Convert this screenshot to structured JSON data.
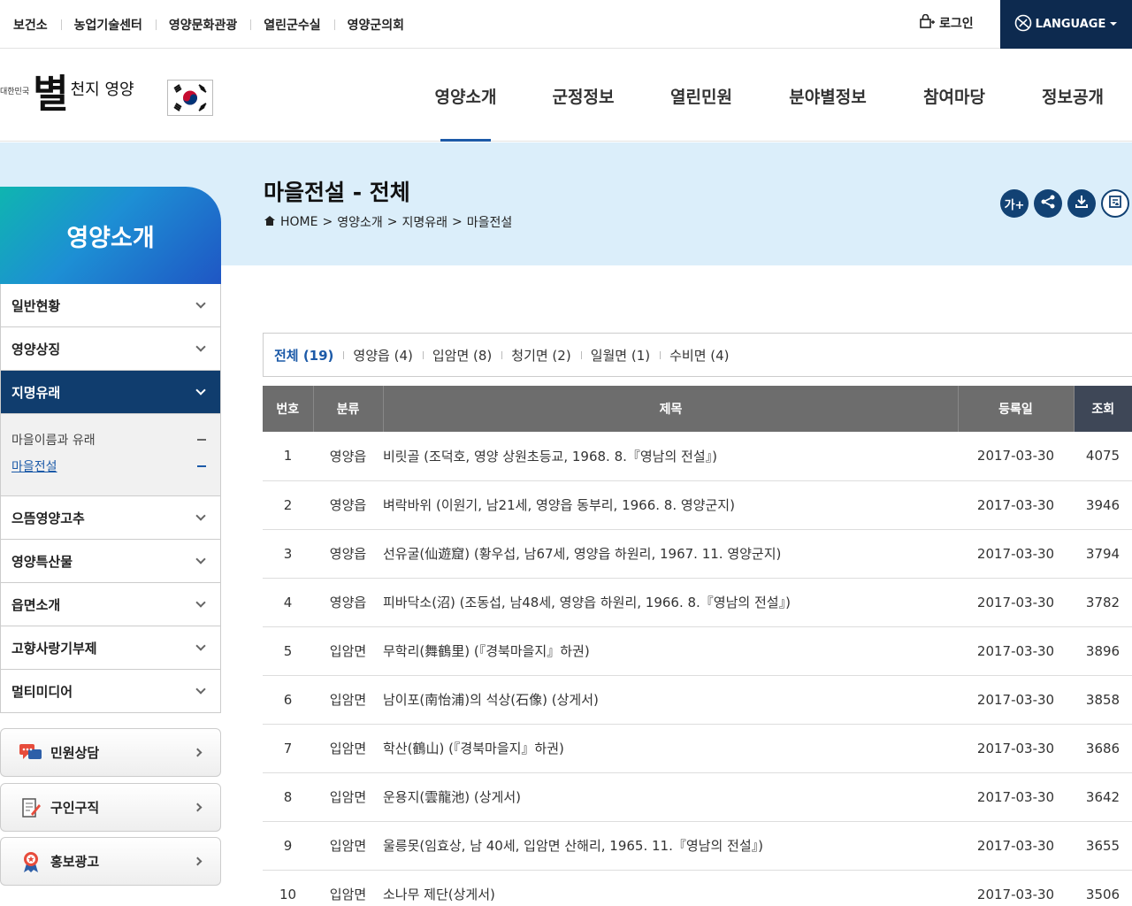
{
  "top_links": [
    "보건소",
    "농업기술센터",
    "영양문화관광",
    "열린군수실",
    "영양군의회"
  ],
  "login_label": "로그인",
  "language_label": "LANGUAGE",
  "logo": {
    "small": "대한민국",
    "main": "별",
    "sub": "천지 영양"
  },
  "gnb": [
    "영양소개",
    "군정정보",
    "열린민원",
    "분야별정보",
    "참여마당",
    "정보공개"
  ],
  "page_title": "마을전설 - 전체",
  "breadcrumb": [
    "HOME",
    "영양소개",
    "지명유래",
    "마을전설"
  ],
  "tools": [
    "가+",
    "share-icon",
    "download-icon",
    "print-icon"
  ],
  "sidebar": {
    "title": "영양소개",
    "items": [
      "일반현황",
      "영양상징",
      "지명유래",
      "으뜸영양고추",
      "영양특산물",
      "읍면소개",
      "고향사랑기부제",
      "멀티미디어"
    ],
    "sub_items": [
      "마을이름과 유래",
      "마을전설"
    ]
  },
  "quick_buttons": [
    "민원상담",
    "구인구직",
    "홍보광고"
  ],
  "tabs": [
    "전체 (19)",
    "영양읍 (4)",
    "입암면 (8)",
    "청기면 (2)",
    "일월면 (1)",
    "수비면 (4)"
  ],
  "table": {
    "headers": [
      "번호",
      "분류",
      "제목",
      "등록일",
      "조회"
    ],
    "rows": [
      [
        "1",
        "영양읍",
        "비릿골 (조덕호, 영양 상원초등교, 1968. 8.『영남의 전설』)",
        "2017-03-30",
        "4075"
      ],
      [
        "2",
        "영양읍",
        "벼락바위 (이원기, 남21세, 영양읍 동부리, 1966. 8. 영양군지)",
        "2017-03-30",
        "3946"
      ],
      [
        "3",
        "영양읍",
        "선유굴(仙遊窟) (황우섭, 남67세, 영양읍 하원리, 1967. 11. 영양군지)",
        "2017-03-30",
        "3794"
      ],
      [
        "4",
        "영양읍",
        "피바닥소(沼) (조동섭, 남48세, 영양읍 하원리, 1966. 8.『영남의 전설』)",
        "2017-03-30",
        "3782"
      ],
      [
        "5",
        "입암면",
        "무학리(舞鶴里) (『경북마을지』하권)",
        "2017-03-30",
        "3896"
      ],
      [
        "6",
        "입암면",
        "남이포(南怡浦)의 석상(石像) (상게서)",
        "2017-03-30",
        "3858"
      ],
      [
        "7",
        "입암면",
        "학산(鶴山) (『경북마을지』하권)",
        "2017-03-30",
        "3686"
      ],
      [
        "8",
        "입암면",
        "운용지(雲龍池) (상게서)",
        "2017-03-30",
        "3642"
      ],
      [
        "9",
        "입암면",
        "울릉못(임효상, 남 40세, 입암면 산해리, 1965. 11.『영남의 전설』)",
        "2017-03-30",
        "3655"
      ],
      [
        "10",
        "입암면",
        "소나무 제단(상게서)",
        "2017-03-30",
        "3506"
      ]
    ]
  },
  "colors": {
    "navy": "#0d2a4f",
    "accent": "#1c5aa8",
    "band": "#dbeefa"
  }
}
